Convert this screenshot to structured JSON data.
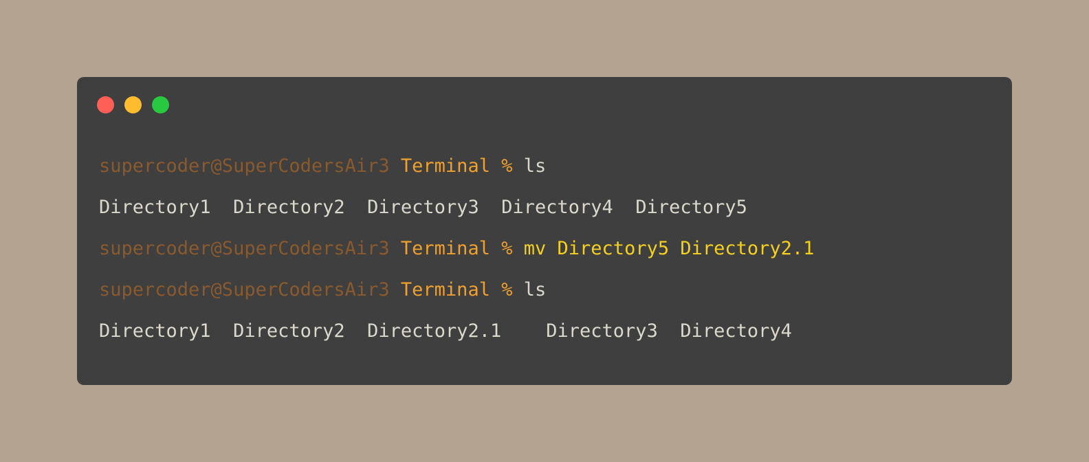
{
  "window": {
    "buttons": [
      "close",
      "minimize",
      "maximize"
    ],
    "colors": {
      "close": "#ff5f57",
      "minimize": "#febc2e",
      "maximize": "#28c840"
    }
  },
  "terminal": {
    "lines": [
      {
        "type": "command",
        "user": "supercoder@SuperCodersAir3",
        "dir": "Terminal",
        "symbol": "%",
        "command": "ls",
        "args": ""
      },
      {
        "type": "output",
        "entries": [
          "Directory1",
          "Directory2",
          "Directory3",
          "Directory4",
          "Directory5"
        ]
      },
      {
        "type": "command",
        "user": "supercoder@SuperCodersAir3",
        "dir": "Terminal",
        "symbol": "%",
        "command": "mv",
        "args": "Directory5 Directory2.1"
      },
      {
        "type": "command",
        "user": "supercoder@SuperCodersAir3",
        "dir": "Terminal",
        "symbol": "%",
        "command": "ls",
        "args": ""
      },
      {
        "type": "output",
        "entries": [
          "Directory1",
          "Directory2",
          "Directory2.1",
          "Directory3",
          "Directory4"
        ]
      }
    ]
  }
}
